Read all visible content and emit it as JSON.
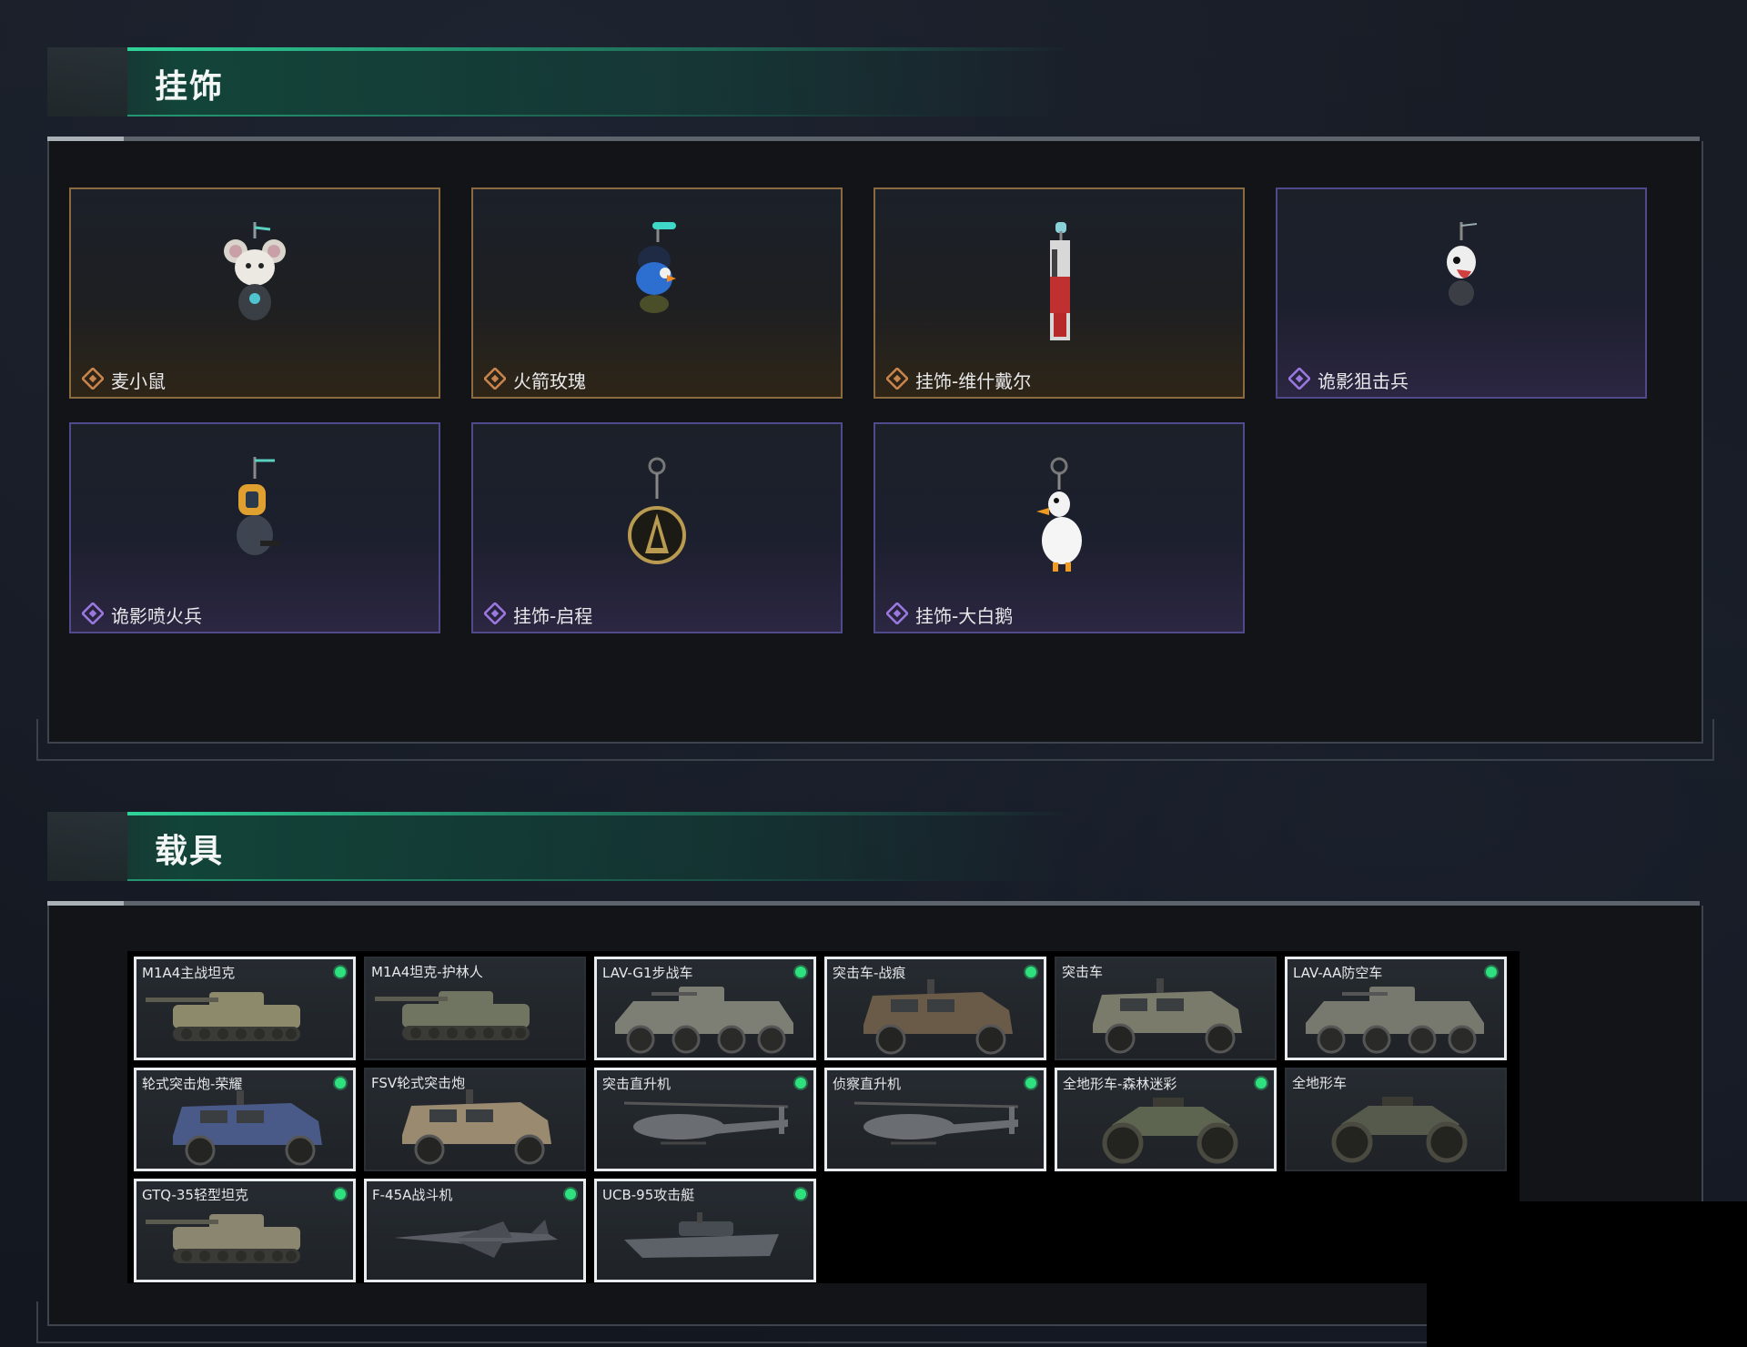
{
  "charms_section": {
    "title": "挂饰",
    "items": [
      {
        "name": "麦小鼠",
        "rarity": "gold"
      },
      {
        "name": "火箭玫瑰",
        "rarity": "gold"
      },
      {
        "name": "挂饰-维什戴尔",
        "rarity": "gold"
      },
      {
        "name": "诡影狙击兵",
        "rarity": "purple"
      },
      {
        "name": "诡影喷火兵",
        "rarity": "purple"
      },
      {
        "name": "挂饰-启程",
        "rarity": "purple"
      },
      {
        "name": "挂饰-大白鹅",
        "rarity": "purple"
      }
    ]
  },
  "vehicles_section": {
    "title": "载具",
    "items": [
      {
        "name": "M1A4主战坦克",
        "selected": true,
        "owned": true
      },
      {
        "name": "M1A4坦克-护林人",
        "selected": false,
        "owned": false
      },
      {
        "name": "LAV-G1步战车",
        "selected": true,
        "owned": true
      },
      {
        "name": "突击车-战痕",
        "selected": true,
        "owned": true
      },
      {
        "name": "突击车",
        "selected": false,
        "owned": false
      },
      {
        "name": "LAV-AA防空车",
        "selected": true,
        "owned": true
      },
      {
        "name": "轮式突击炮-荣耀",
        "selected": true,
        "owned": true
      },
      {
        "name": "FSV轮式突击炮",
        "selected": false,
        "owned": false
      },
      {
        "name": "突击直升机",
        "selected": true,
        "owned": true
      },
      {
        "name": "侦察直升机",
        "selected": true,
        "owned": true
      },
      {
        "name": "全地形车-森林迷彩",
        "selected": true,
        "owned": true
      },
      {
        "name": "全地形车",
        "selected": false,
        "owned": false
      },
      {
        "name": "GTQ-35轻型坦克",
        "selected": true,
        "owned": true
      },
      {
        "name": "F-45A战斗机",
        "selected": true,
        "owned": true
      },
      {
        "name": "UCB-95攻击艇",
        "selected": true,
        "owned": true
      }
    ]
  },
  "colors": {
    "accent_green": "#2fd39a",
    "owned_dot": "#2fe07f",
    "rarity_gold": "#c8844a",
    "rarity_purple": "#9a78e0"
  }
}
